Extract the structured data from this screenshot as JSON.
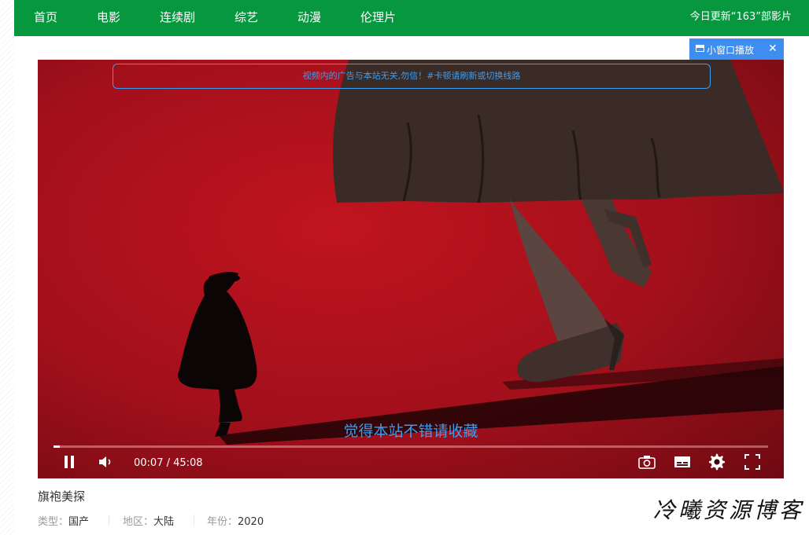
{
  "nav": {
    "items": [
      {
        "label": "首页"
      },
      {
        "label": "电影"
      },
      {
        "label": "连续剧"
      },
      {
        "label": "综艺"
      },
      {
        "label": "动漫"
      },
      {
        "label": "伦理片"
      }
    ],
    "update_text": "今日更新“163”部影片"
  },
  "player": {
    "mini_window_label": "小窗口播放",
    "ad_notice": "视频内的广告与本站无关,勿信！#卡顿请刷新或切换线路",
    "subtitle": "觉得本站不错请收藏",
    "current_time": "00:07",
    "duration": "45:08",
    "time_display": "00:07 / 45:08",
    "progress_fraction": 0.0026,
    "accent_color": "#3d9df0"
  },
  "video": {
    "title": "旗袍美探",
    "type_label": "类型：",
    "type_value": "国产",
    "region_label": "地区：",
    "region_value": "大陆",
    "year_label": "年份：",
    "year_value": "2020"
  },
  "watermark": "冷曦资源博客",
  "colors": {
    "nav_bg": "#07983f",
    "mini_btn_bg": "#3d8ef0"
  }
}
